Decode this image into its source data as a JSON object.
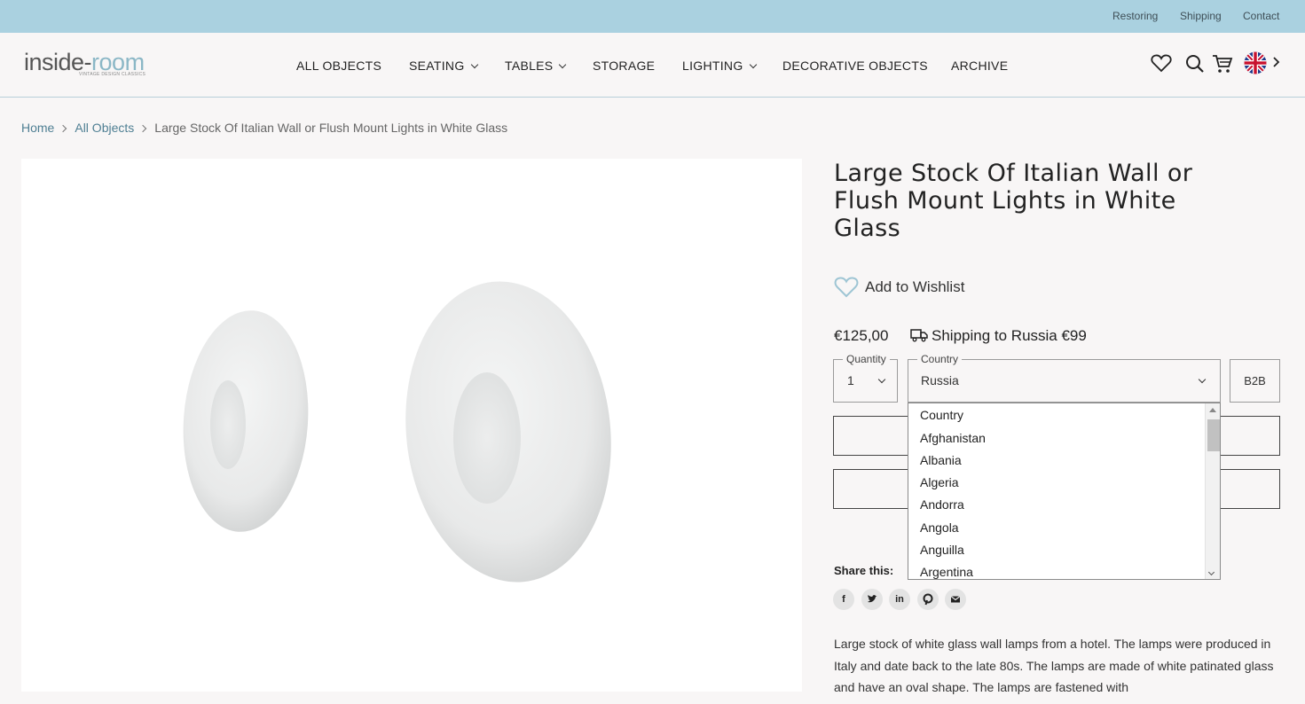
{
  "topbar": {
    "links": [
      "Restoring",
      "Shipping",
      "Contact"
    ]
  },
  "header": {
    "logo_text_main": "inside-",
    "logo_text_accent": "room",
    "logo_tagline": "VINTAGE DESIGN CLASSICS",
    "nav": [
      {
        "label": "ALL OBJECTS",
        "has_dropdown": false
      },
      {
        "label": "SEATING",
        "has_dropdown": true
      },
      {
        "label": "TABLES",
        "has_dropdown": true
      },
      {
        "label": "STORAGE",
        "has_dropdown": false
      },
      {
        "label": "LIGHTING",
        "has_dropdown": true
      },
      {
        "label": "DECORATIVE OBJECTS",
        "has_dropdown": false
      },
      {
        "label": "ARCHIVE",
        "has_dropdown": false
      }
    ],
    "icons": [
      "heart-icon",
      "search-icon",
      "cart-icon",
      "uk-flag-icon",
      "chevron-right-icon"
    ]
  },
  "breadcrumb": {
    "home": "Home",
    "all_objects": "All Objects",
    "current": "Large Stock Of Italian Wall or Flush Mount Lights in White Glass"
  },
  "product": {
    "title": "Large Stock Of Italian Wall or Flush Mount Lights in White Glass",
    "wishlist_label": "Add to Wishlist",
    "price": "€125,00",
    "shipping": "Shipping to Russia €99",
    "quantity_label": "Quantity",
    "quantity_value": "1",
    "country_label": "Country",
    "country_value": "Russia",
    "b2b_label": "B2B",
    "share_label": "Share this:",
    "social": [
      "facebook-icon",
      "twitter-icon",
      "linkedin-icon",
      "pinterest-icon",
      "email-icon"
    ],
    "description": "Large stock of white glass wall lamps from a hotel. The lamps were produced in Italy and date back to the late 80s. The lamps are made of white patinated glass and have an oval shape. The lamps are fastened with"
  },
  "country_dropdown": {
    "options": [
      "Country",
      "Afghanistan",
      "Albania",
      "Algeria",
      "Andorra",
      "Angola",
      "Anguilla",
      "Argentina"
    ]
  },
  "colors": {
    "topbar": "#aad1e0",
    "accent": "#8bb7c6",
    "background": "#f8f6f6"
  }
}
